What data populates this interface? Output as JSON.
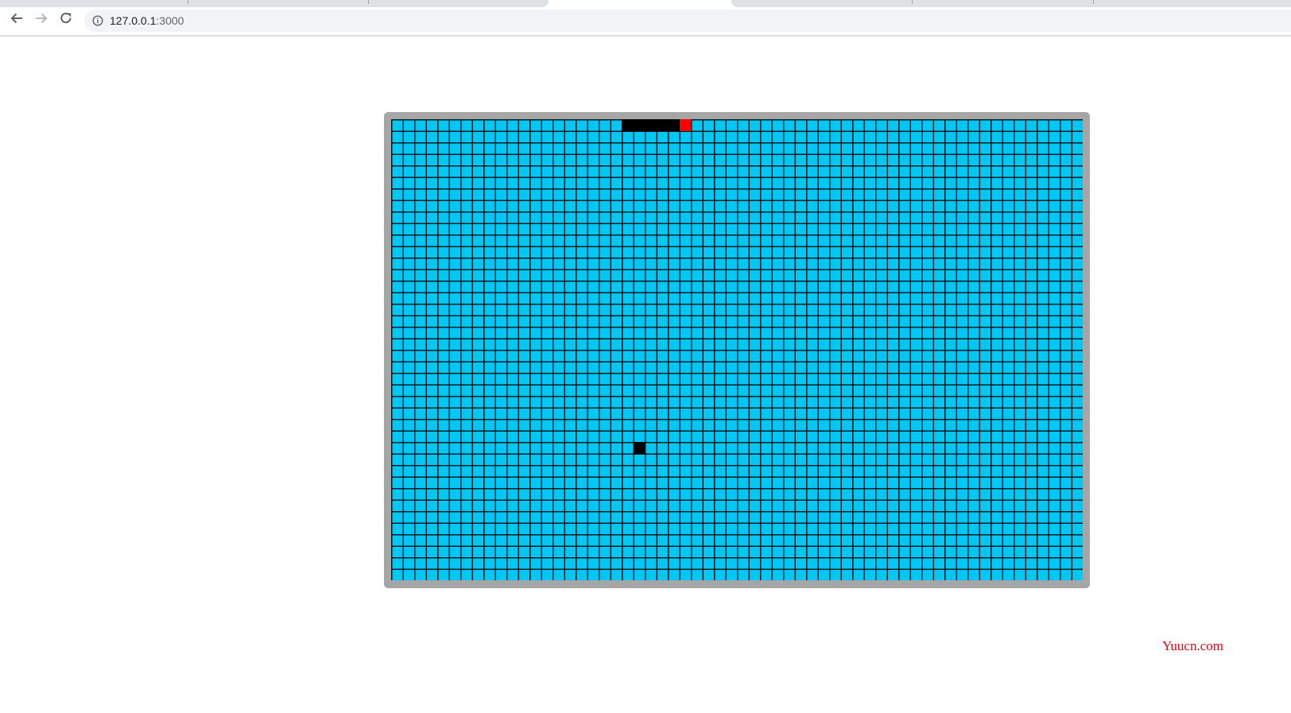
{
  "browser": {
    "address_bar": {
      "host": "127.0.0.1",
      "port": ":3000",
      "icon": "info-icon"
    },
    "back_icon": "arrow-left-icon",
    "forward_icon": "arrow-right-icon",
    "reload_icon": "reload-icon"
  },
  "game": {
    "board": {
      "columns": 60,
      "rows": 40,
      "background_color": "#00c8f5",
      "grid_line_color": "#0a1a20",
      "frame_color": "#a6a6a6"
    },
    "snake": {
      "head": {
        "col": 25,
        "row": 0
      },
      "body": [
        {
          "col": 20,
          "row": 0
        },
        {
          "col": 21,
          "row": 0
        },
        {
          "col": 22,
          "row": 0
        },
        {
          "col": 23,
          "row": 0
        },
        {
          "col": 24,
          "row": 0
        }
      ],
      "head_color": "#ff0000",
      "body_color": "#000000"
    },
    "food": {
      "col": 21,
      "row": 28,
      "color": "#000000"
    }
  },
  "watermark": {
    "text": "Yuucn.com",
    "color": "#e60012"
  }
}
